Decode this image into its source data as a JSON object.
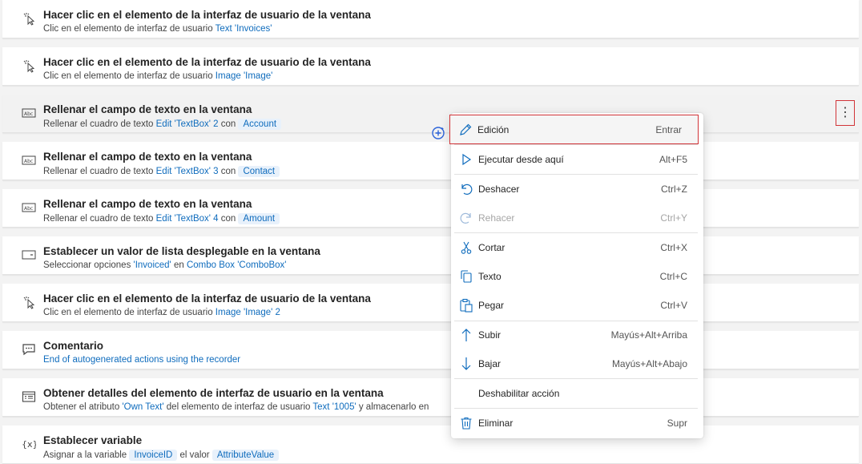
{
  "actions": [
    {
      "title": "Hacer clic en el elemento de la interfaz de usuario de la ventana",
      "icon": "cursor-click-icon",
      "sub": {
        "t1": "Clic en el elemento de interfaz de usuario ",
        "l1": "Text 'Invoices'"
      }
    },
    {
      "title": "Hacer clic en el elemento de la interfaz de usuario de la ventana",
      "icon": "cursor-click-icon",
      "sub": {
        "t1": "Clic en el elemento de interfaz de usuario ",
        "l1": "Image 'Image'"
      }
    },
    {
      "title": "Rellenar el campo de texto en la ventana",
      "icon": "textbox-icon",
      "sub": {
        "t1": "Rellenar el cuadro de texto ",
        "l1": "Edit 'TextBox' 2",
        "t2": " con ",
        "c1": "Account"
      }
    },
    {
      "title": "Rellenar el campo de texto en la ventana",
      "icon": "textbox-icon",
      "sub": {
        "t1": "Rellenar el cuadro de texto ",
        "l1": "Edit 'TextBox' 3",
        "t2": " con ",
        "c1": "Contact"
      }
    },
    {
      "title": "Rellenar el campo de texto en la ventana",
      "icon": "textbox-icon",
      "sub": {
        "t1": "Rellenar el cuadro de texto ",
        "l1": "Edit 'TextBox' 4",
        "t2": " con ",
        "c1": "Amount"
      }
    },
    {
      "title": "Establecer un valor de lista desplegable en la ventana",
      "icon": "dropdown-icon",
      "sub": {
        "t1": "Seleccionar opciones ",
        "l1": "'Invoiced'",
        "t2": " en ",
        "l2": "Combo Box 'ComboBox'"
      }
    },
    {
      "title": "Hacer clic en el elemento de la interfaz de usuario de la ventana",
      "icon": "cursor-click-icon",
      "sub": {
        "t1": "Clic en el elemento de interfaz de usuario ",
        "l1": "Image 'Image' 2"
      }
    },
    {
      "title": "Comentario",
      "icon": "comment-icon",
      "sub": {
        "l1": "End of autogenerated actions using the recorder"
      }
    },
    {
      "title": "Obtener detalles del elemento de interfaz de usuario en la ventana",
      "icon": "details-icon",
      "sub": {
        "t1": "Obtener el atributo ",
        "l1": "'Own Text'",
        "t2": " del elemento de interfaz de usuario ",
        "l2": "Text '1005'",
        "t3": " y almacenarlo en"
      }
    },
    {
      "title": "Establecer variable",
      "icon": "variable-icon",
      "sub": {
        "t1": "Asignar a la variable ",
        "c1": "InvoiceID",
        "t2": " el valor ",
        "c2": "AttributeValue"
      }
    }
  ],
  "more_button_label": "⋮",
  "context_menu": {
    "items": [
      {
        "label": "Edición",
        "key": "Entrar",
        "icon": "pencil-icon"
      },
      {
        "label": "Ejecutar desde aquí",
        "key": "Alt+F5",
        "icon": "play-icon"
      },
      {
        "label": "Deshacer",
        "key": "Ctrl+Z",
        "icon": "undo-icon"
      },
      {
        "label": "Rehacer",
        "key": "Ctrl+Y",
        "icon": "redo-icon",
        "disabled": true
      },
      {
        "label": "Cortar",
        "key": "Ctrl+X",
        "icon": "scissors-icon"
      },
      {
        "label": "Texto",
        "key": "Ctrl+C",
        "icon": "copy-icon"
      },
      {
        "label": "Pegar",
        "key": "Ctrl+V",
        "icon": "paste-icon"
      },
      {
        "label": "Subir",
        "key": "Mayús+Alt+Arriba",
        "icon": "arrow-up-icon"
      },
      {
        "label": "Bajar",
        "key": "Mayús+Alt+Abajo",
        "icon": "arrow-down-icon"
      },
      {
        "label": "Deshabilitar acción",
        "key": "",
        "icon": ""
      },
      {
        "label": "Eliminar",
        "key": "Supr",
        "icon": "trash-icon"
      }
    ]
  },
  "colors": {
    "link": "#0f6cbd",
    "focus_outline": "#d13438",
    "chip_bg": "#e8f1fb"
  }
}
